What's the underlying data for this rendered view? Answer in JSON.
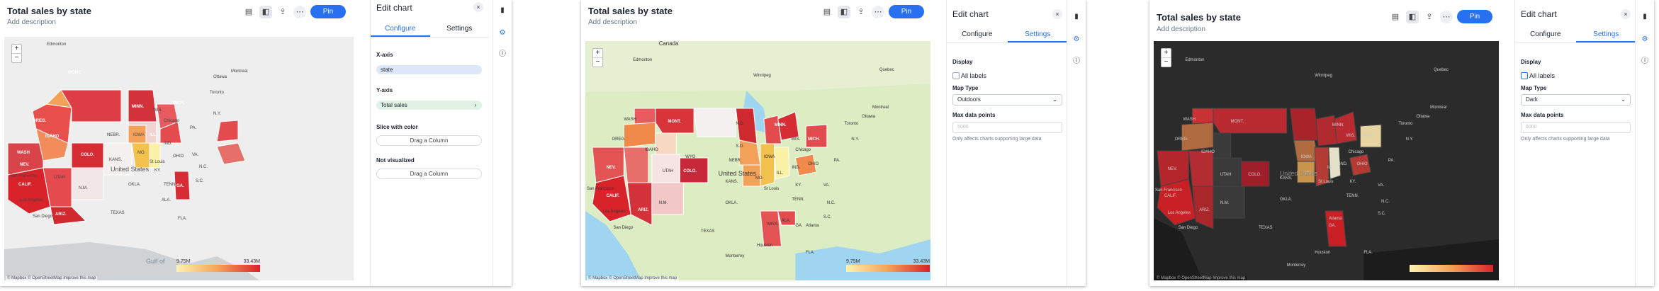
{
  "panels": [
    {
      "title": "Total sales by state",
      "description": "Add description",
      "pin_label": "Pin",
      "map_style": "light",
      "legend_min": "9.75M",
      "legend_max": "33.43M",
      "attribution": "© Mapbox © OpenStreetMap Improve this map",
      "map_labels": [
        "Edmonton",
        "MONT.",
        "WASH",
        "OREG.",
        "IDAHO",
        "NEV.",
        "CALIF.",
        "UTAH",
        "COLO.",
        "ARIZ.",
        "N.M.",
        "NEBR.",
        "KANS.",
        "OKLA.",
        "TEXAS",
        "MINN.",
        "IOWA",
        "MO.",
        "ILL.",
        "IND.",
        "OHIO",
        "KY.",
        "TENN.",
        "ALA.",
        "GA.",
        "FLA.",
        "S.C.",
        "N.C.",
        "VA.",
        "PA.",
        "N.Y.",
        "WIS.",
        "MICH.",
        "Chicago",
        "St Louis",
        "San Francisco",
        "Los Angeles",
        "San Diego",
        "Toronto",
        "Ottawa",
        "Montreal",
        "United States",
        "Gulf of"
      ],
      "edit": {
        "title": "Edit chart",
        "close": "×",
        "tab_configure": "Configure",
        "tab_settings": "Settings",
        "active_tab": "configure",
        "x_axis_label": "X-axis",
        "x_axis_value": "state",
        "y_axis_label": "Y-axis",
        "y_axis_value": "Total sales",
        "slice_label": "Slice with color",
        "slice_drop": "Drag a Column",
        "not_visualized_label": "Not visualized",
        "not_visualized_drop": "Drag a Column"
      }
    },
    {
      "title": "Total sales by state",
      "description": "Add description",
      "pin_label": "Pin",
      "map_style": "outdoors",
      "legend_min": "9.75M",
      "legend_max": "33.43M",
      "attribution": "© Mapbox © OpenStreetMap Improve this map",
      "map_labels": [
        "Canada",
        "Edmonton",
        "Winnipeg",
        "Quebec",
        "WASH",
        "MONT.",
        "N.D.",
        "S.D.",
        "OREG.",
        "IDAHO",
        "WYO",
        "NEV.",
        "CALIF.",
        "UTAH",
        "COLO.",
        "ARIZ.",
        "N.M.",
        "NEBR.",
        "KANS.",
        "OKLA.",
        "TEXAS",
        "MINN.",
        "IOWA",
        "MO.",
        "WIS.",
        "MICH.",
        "ILL.",
        "IND.",
        "OHIO",
        "KY.",
        "TENN.",
        "MISS",
        "ALA.",
        "GA.",
        "FLA.",
        "S.C.",
        "N.C.",
        "VA.",
        "PA.",
        "N.Y.",
        "Chicago",
        "St Louis",
        "San Francisco",
        "Los Angeles",
        "San Diego",
        "Toronto",
        "Montreal",
        "Ottawa",
        "United States",
        "Monterrey",
        "Houston",
        "Atlanta"
      ],
      "edit": {
        "title": "Edit chart",
        "close": "×",
        "tab_configure": "Configure",
        "tab_settings": "Settings",
        "active_tab": "settings",
        "display_label": "Display",
        "all_labels": "All labels",
        "map_type_label": "Map Type",
        "map_type_value": "Outdoors",
        "max_points_label": "Max data points",
        "max_points_placeholder": "5000",
        "hint": "Only affects charts supporting large data"
      }
    },
    {
      "title": "Total sales by state",
      "description": "Add description",
      "pin_label": "Pin",
      "map_style": "dark",
      "legend_min": "",
      "legend_max": "",
      "attribution": "© Mapbox © OpenStreetMap Improve this map",
      "map_labels": [
        "Edmonton",
        "Winnipeg",
        "Quebec",
        "WASH",
        "MONT.",
        "OREG.",
        "IDAHO",
        "NEV.",
        "CALIF.",
        "UTAH",
        "COLO.",
        "ARIZ.",
        "N.M.",
        "KANS.",
        "OKLA.",
        "TEXAS",
        "MINN.",
        "IOWA",
        "MO.",
        "WIS.",
        "MICH.",
        "ILL.",
        "IND.",
        "OHIO",
        "KY.",
        "TENN.",
        "GA.",
        "FLA.",
        "S.C.",
        "N.C.",
        "VA.",
        "PA.",
        "N.Y.",
        "Chicago",
        "St Louis",
        "San Francisco",
        "Los Angeles",
        "San Diego",
        "Toronto",
        "Ottawa",
        "Montreal",
        "United States",
        "Houston",
        "Atlanta",
        "Monterrey"
      ],
      "edit": {
        "title": "Edit chart",
        "close": "×",
        "tab_configure": "Configure",
        "tab_settings": "Settings",
        "active_tab": "settings",
        "display_label": "Display",
        "all_labels": "All labels",
        "map_type_label": "Map Type",
        "map_type_value": "Dark",
        "max_points_label": "Max data points",
        "max_points_placeholder": "5000",
        "hint": "Only affects charts supporting large data"
      }
    }
  ],
  "icons": {
    "table": "table-icon",
    "chart": "chart-icon",
    "share": "share-icon",
    "more": "more-icon",
    "close": "close-icon",
    "bar_chart": "bar-chart-icon",
    "gear": "gear-icon",
    "info": "info-icon",
    "zoom_in": "zoom-in-icon",
    "zoom_out": "zoom-out-icon"
  },
  "colors": {
    "accent": "#2770ef",
    "choropleth_low": "#fff3b0",
    "choropleth_mid": "#f4a259",
    "choropleth_high": "#d8232a"
  }
}
